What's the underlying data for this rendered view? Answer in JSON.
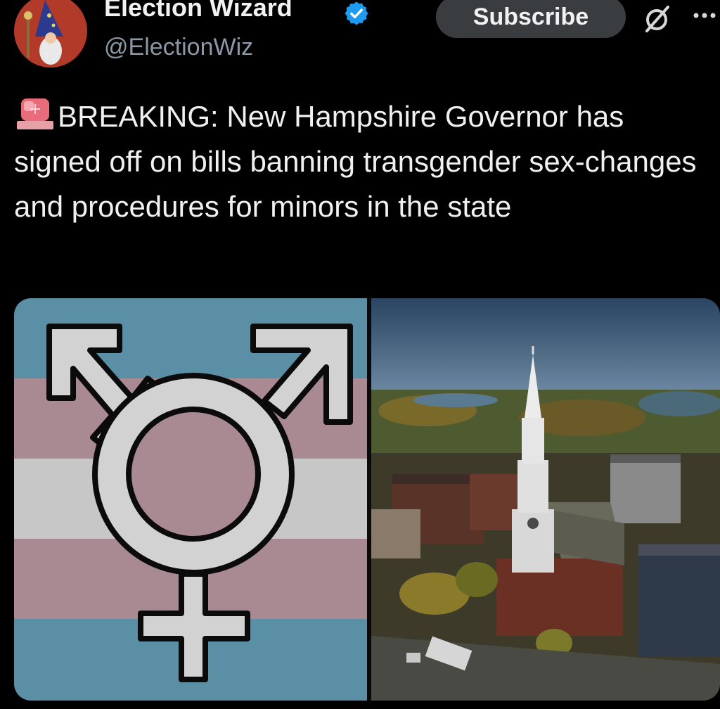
{
  "author": {
    "display_name": "Election Wizard",
    "handle": "@ElectionWiz",
    "verified": true
  },
  "actions": {
    "subscribe_label": "Subscribe",
    "grok_icon": "grok-slash-circle-icon",
    "more_icon": "more-dots-icon"
  },
  "tweet": {
    "emoji": "police-siren-light",
    "text": "BREAKING: New Hampshire Governor has signed off on bills banning transgender sex-changes and procedures for minors in the state"
  },
  "media": {
    "left_image": "transgender symbol on pastel blue, pink and white striped flag",
    "right_image": "aerial view of a white church steeple among brick buildings and autumn trees"
  },
  "colors": {
    "background": "#000000",
    "accent_verified": "#1d9bf0",
    "flag_blue": "#5b8fa6",
    "flag_pink": "#a98a92",
    "flag_white": "#c7c7c7"
  }
}
